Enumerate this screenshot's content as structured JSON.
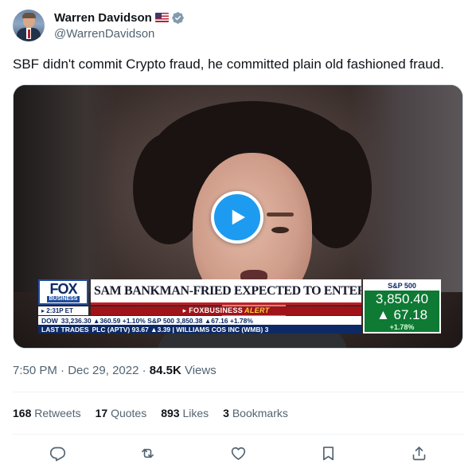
{
  "author": {
    "display_name": "Warren Davidson",
    "handle": "@WarrenDavidson",
    "flag_icon": "us-flag-icon",
    "verified_icon": "verified-badge-icon",
    "verified_color": "#829aab"
  },
  "tweet": {
    "text": "SBF didn't commit Crypto fraud, he committed plain old fashioned fraud."
  },
  "media": {
    "type": "video",
    "play_icon": "play-icon",
    "accent": "#1d9bf0",
    "chyron": {
      "logo_main": "FOX",
      "logo_sub": "BUSINESS",
      "headline": "SAM BANKMAN-FRIED EXPECTED TO ENTER PLEA DEAL",
      "time": "2:31P ET",
      "alert_brand": "FOXBUSINESS",
      "alert_word": "ALERT",
      "ticker_line1_label": "DOW",
      "ticker_line1": "33,236.30 ▲360.59 +1.10% S&P 500 3,850.38 ▲67.16 +1.78%",
      "ticker_line2_label": "LAST TRADES",
      "ticker_line2": "PLC (APTV) 93.67 ▲3.39 | WILLIAMS COS INC (WMB) 3",
      "index_label": "S&P 500",
      "index_value": "3,850.40",
      "index_change": "▲ 67.18",
      "index_pct": "+1.78%"
    }
  },
  "meta": {
    "time": "7:50 PM",
    "sep1": " · ",
    "date": "Dec 29, 2022",
    "sep2": " · ",
    "views_count": "84.5K",
    "views_label": " Views"
  },
  "stats": {
    "retweets_count": "168",
    "retweets_label": " Retweets",
    "quotes_count": "17",
    "quotes_label": " Quotes",
    "likes_count": "893",
    "likes_label": " Likes",
    "bookmarks_count": "3",
    "bookmarks_label": " Bookmarks"
  },
  "actions": [
    {
      "name": "reply",
      "icon": "reply-icon"
    },
    {
      "name": "retweet",
      "icon": "retweet-icon"
    },
    {
      "name": "like",
      "icon": "heart-icon"
    },
    {
      "name": "bookmark",
      "icon": "bookmark-icon"
    },
    {
      "name": "share",
      "icon": "share-icon"
    }
  ],
  "colors": {
    "text_primary": "#0f1419",
    "text_secondary": "#536471",
    "action_icon": "#536471"
  }
}
